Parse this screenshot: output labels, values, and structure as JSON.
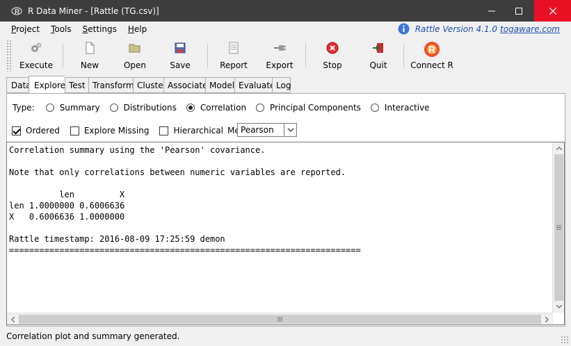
{
  "window": {
    "title": "R Data Miner - [Rattle (TG.csv)]",
    "icon": "r-logo-icon",
    "controls": {
      "minimize": "minimize-icon",
      "maximize": "maximize-icon",
      "close": "close-icon"
    }
  },
  "menu": {
    "items": [
      {
        "key": "P",
        "rest": "roject"
      },
      {
        "key": "T",
        "rest": "ools"
      },
      {
        "key": "S",
        "rest": "ettings"
      },
      {
        "key": "H",
        "rest": "elp"
      }
    ],
    "version_text": "Rattle Version 4.1.0",
    "version_link": "togaware.com"
  },
  "toolbar": {
    "buttons": [
      {
        "label": "Execute",
        "icon": "gears-icon"
      },
      {
        "label": "New",
        "icon": "new-document-icon"
      },
      {
        "label": "Open",
        "icon": "folder-icon"
      },
      {
        "label": "Save",
        "icon": "floppy-icon"
      },
      {
        "label": "Report",
        "icon": "report-icon"
      },
      {
        "label": "Export",
        "icon": "export-plug-icon"
      },
      {
        "label": "Stop",
        "icon": "stop-icon"
      },
      {
        "label": "Quit",
        "icon": "exit-door-icon"
      },
      {
        "label": "Connect R",
        "icon": "r-logo-icon"
      }
    ]
  },
  "tabs": [
    "Data",
    "Explore",
    "Test",
    "Transform",
    "Cluster",
    "Associate",
    "Model",
    "Evaluate",
    "Log"
  ],
  "active_tab": "Explore",
  "explore": {
    "type_label": "Type:",
    "types": [
      "Summary",
      "Distributions",
      "Correlation",
      "Principal Components",
      "Interactive"
    ],
    "selected_type": "Correlation",
    "options": {
      "ordered_label": "Ordered",
      "ordered_checked": true,
      "explore_missing_label": "Explore Missing",
      "explore_missing_checked": false,
      "hierarchical_label": "Hierarchical",
      "hierarchical_checked": false,
      "method_label": "Method:",
      "method_value": "Pearson"
    }
  },
  "output": {
    "lines": [
      "Correlation summary using the 'Pearson' covariance.",
      "",
      "Note that only correlations between numeric variables are reported.",
      "",
      "          len         X",
      "len 1.0000000 0.6006636",
      "X   0.6006636 1.0000000",
      "",
      "Rattle timestamp: 2016-08-09 17:25:59 demon",
      "======================================================================"
    ]
  },
  "status": "Correlation plot and summary generated.",
  "colors": {
    "titlebar": "#3d3d3d",
    "close": "#e81123",
    "link": "#1f4fb3",
    "stop": "#e03030"
  }
}
